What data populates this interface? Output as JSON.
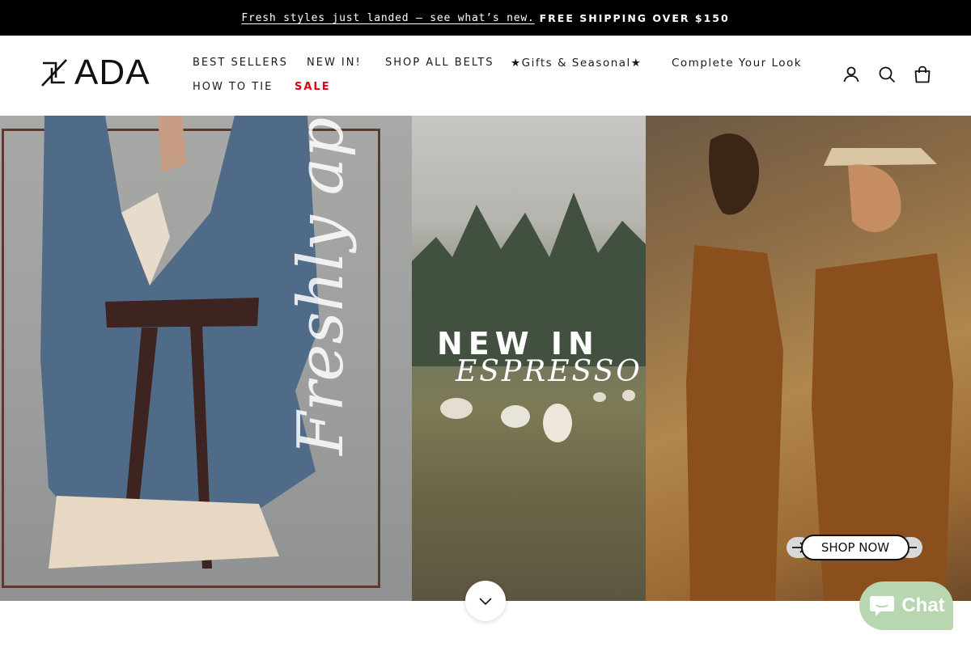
{
  "announcement": {
    "link_text": "Fresh styles just landed — see what’s new.",
    "bold_text": "FREE SHIPPING OVER $150"
  },
  "header": {
    "logo_text": "ADA",
    "nav": [
      {
        "label": "BEST SELLERS"
      },
      {
        "label": "NEW IN!"
      },
      {
        "label": "SHOP ALL BELTS"
      },
      {
        "label": "★Gifts & Seasonal★"
      },
      {
        "label": "Complete Your Look"
      },
      {
        "label": "HOW TO TIE"
      },
      {
        "label": "SALE"
      }
    ],
    "icons": [
      "account-icon",
      "search-icon",
      "cart-icon"
    ]
  },
  "hero": {
    "script_text": "Freshly applied",
    "headline": "NEW IN",
    "subheadline": "ESPRESSO",
    "cta": "SHOP NOW"
  },
  "chat": {
    "label": "Chat"
  },
  "colors": {
    "announcement_bg": "#000000",
    "sale": "#e0000f",
    "chat_bg": "#b8d6b0"
  }
}
